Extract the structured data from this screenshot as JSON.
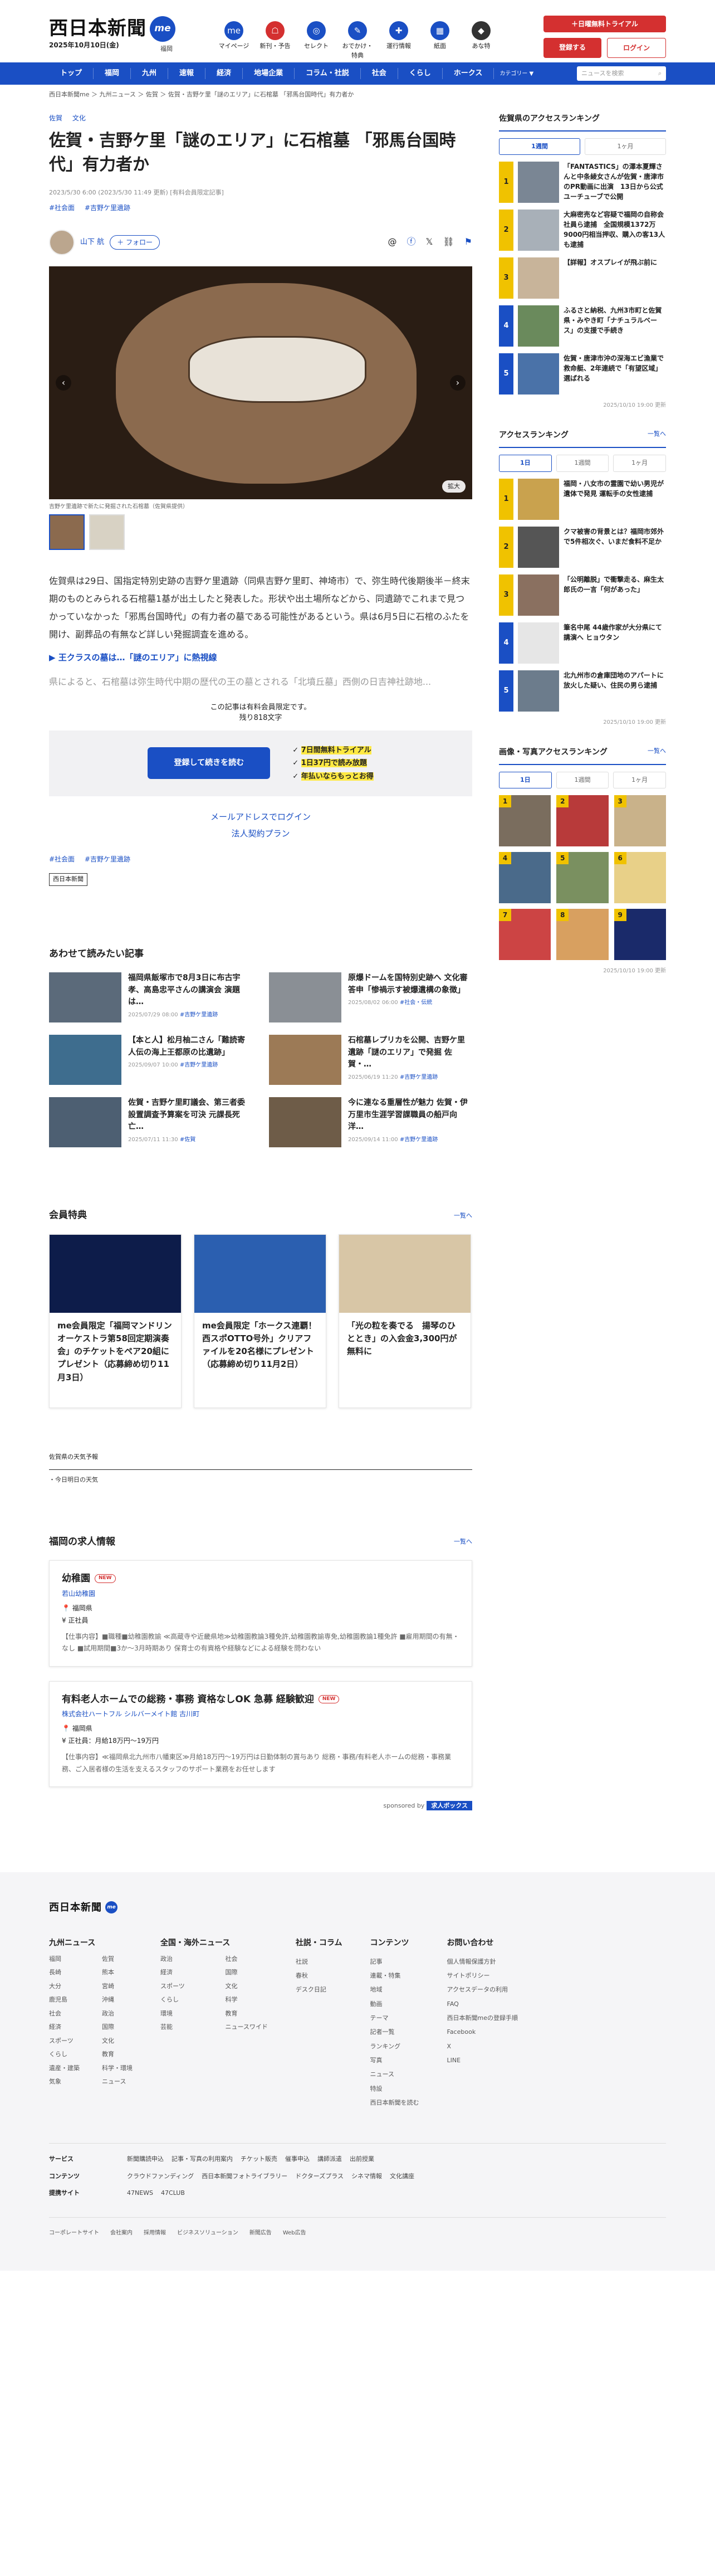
{
  "header": {
    "logo": "西日本新聞",
    "me": "me",
    "date": "2025年10月10日(金)",
    "location": "福岡",
    "icons": [
      {
        "label": "マイページ",
        "glyph": "me"
      },
      {
        "label": "新刊・予告",
        "glyph": "☖"
      },
      {
        "label": "セレクト",
        "glyph": "◎"
      },
      {
        "label": "おでかけ・特典",
        "glyph": "✎"
      },
      {
        "label": "運行情報",
        "glyph": "✚"
      },
      {
        "label": "紙面",
        "glyph": "▦"
      },
      {
        "label": "あな特",
        "glyph": "◆"
      }
    ],
    "trial": "＋日曜無料トライアル",
    "register": "登録する",
    "login": "ログイン"
  },
  "nav": {
    "items": [
      "トップ",
      "福岡",
      "九州",
      "速報",
      "経済",
      "地場企業",
      "コラム・社説",
      "社会",
      "くらし",
      "ホークス"
    ],
    "more": "カテゴリー ▼",
    "search_placeholder": "ニュースを検索"
  },
  "breadcrumb": "西日本新聞me ＞ 九州ニュース ＞ 佐賀 ＞ 佐賀・吉野ケ里「謎のエリア」に石棺墓 「邪馬台国時代」有力者か",
  "article": {
    "categories": [
      "佐賀",
      "文化"
    ],
    "title": "佐賀・吉野ケ里「謎のエリア」に石棺墓 「邪馬台国時代」有力者か",
    "meta": "2023/5/30 6:00 (2023/5/30 11:49 更新) [有料会員限定記事]",
    "tags": [
      "#社会面",
      "#吉野ケ里遺跡"
    ],
    "author": "山下 航",
    "follow": "＋ フォロー",
    "zoom": "拡大",
    "caption": "吉野ケ里遺跡で新たに発掘された石棺墓（佐賀県提供）",
    "p1": "佐賀県は29日、国指定特別史跡の吉野ケ里遺跡（同県吉野ケ里町、神埼市）で、弥生時代後期後半－終末期のものとみられる石棺墓1基が出土したと発表した。形状や出土場所などから、同遺跡でこれまで見つかっていなかった「邪馬台国時代」の有力者の墓である可能性があるという。県は6月5日に石棺のふたを開け、副葬品の有無など詳しい発掘調査を進める。",
    "highlight": "▶ 王クラスの墓は…「謎のエリア」に熱視線",
    "p2": "県によると、石棺墓は弥生時代中期の歴代の王の墓とされる「北墳丘墓」西側の日吉神社跡地...",
    "paywall": "この記事は有料会員限定です。",
    "remaining": "残り818文字",
    "read_btn": "登録して続きを読む",
    "checks": [
      "7日間無料トライアル",
      "1日37円で読み放題",
      "年払いならもっとお得"
    ],
    "mail_login": "メールアドレスでログイン",
    "corp": "法人契約プラン",
    "tags2": [
      "#社会面",
      "#吉野ケ里遺跡"
    ],
    "copyright": "西日本新聞"
  },
  "related": {
    "title": "あわせて読みたい記事",
    "items": [
      {
        "title": "福岡県飯塚市で8月3日に布古宇孝、高島忠平さんの講演会 演題は…",
        "date": "2025/07/29 08:00",
        "tag": "#吉野ケ里遺跡"
      },
      {
        "title": "原爆ドームを国特別史跡へ 文化審答申「惨禍示す被爆遺構の象徴」",
        "date": "2025/08/02 06:00",
        "tag": "#社会・伝統"
      },
      {
        "title": "【本と人】松月柚二さん「難読寄人伝の海上王都原の比遺跡」",
        "date": "2025/09/07 10:00",
        "tag": "#吉野ケ里遺跡"
      },
      {
        "title": "石棺墓レプリカを公開、吉野ケ里遺跡「謎のエリア」で発掘 佐賀・…",
        "date": "2025/06/19 11:20",
        "tag": "#吉野ケ里遺跡"
      },
      {
        "title": "佐賀・吉野ケ里町議会、第三者委設置調査予算案を可決 元課長死亡…",
        "date": "2025/07/11 11:30",
        "tag": "#佐賀"
      },
      {
        "title": "今に連なる重層性が魅力 佐賀・伊万里市生涯学習課職員の船戸向洋…",
        "date": "2025/09/14 11:00",
        "tag": "#吉野ケ里遺跡"
      }
    ]
  },
  "perks": {
    "title": "会員特典",
    "more": "一覧へ",
    "items": [
      "me会員限定「福岡マンドリンオーケストラ第58回定期演奏会」のチケットをペア20組にプレゼント（応募締め切り11月3日）",
      "me会員限定「ホークス連覇！西スポOTTO号外」クリアファイルを20名様にプレゼント（応募締め切り11月2日）",
      "「光の粒を奏でる　揚琴のひととき」の入会金3,300円が無料に"
    ]
  },
  "weather": {
    "title": "佐賀県の天気予報",
    "sub": "・今日明日の天気"
  },
  "jobs": {
    "title": "福岡の求人情報",
    "more": "一覧へ",
    "items": [
      {
        "title": "幼稚園",
        "badge": "NEW",
        "company": "若山幼稚園",
        "place": "福岡県",
        "pay": "正社員",
        "desc": "【仕事内容】■職種■幼稚園教諭 ≪高蔵寺や近畿県地≫幼稚園教論3種免許,幼稚園教諭専免,幼稚園教論1種免許 ■雇用期間の有無・なし ■試用期間■3か〜3月時期あり 保育士の有資格や経験などによる経験を問わない"
      },
      {
        "title": "有料老人ホームでの総務・事務 資格なしOK 急募 経験歓迎",
        "badge": "NEW",
        "company": "株式会社ハートフル シルバーメイト館 古川町",
        "place": "福岡県",
        "pay": "正社員：月給18万円〜19万円",
        "desc": "【仕事内容】≪福岡県北九州市八幡東区≫月給18万円〜19万円は日勤体制の賞与あり 総務・事務/有料老人ホームの総務・事務業務、ご入居者様の生活を支えるスタッフのサポート業務をお任せします"
      }
    ],
    "sponsored": "sponsored by",
    "sponsor": "求人ボックス"
  },
  "sidebar": {
    "rank1_title": "佐賀県のアクセスランキング",
    "rank1_tabs": [
      "1週間",
      "1ヶ月"
    ],
    "rank1": [
      "「FANTASTICS」の澤本夏輝さんと中条綾女さんが佐賀・唐津市のPR動画に出演　13日から公式ユーチューブで公開",
      "大麻密売など容疑で福岡の自称会社員ら逮捕　全国規模1372万9000円相当押収、購入の客13人も逮捕",
      "【詳報】オスプレイが飛ぶ前に",
      "ふるさと納税、九州3市町と佐賀県・みやき町「ナチュラルベース」の支援で手続き",
      "佐賀・唐津市沖の深海エビ漁業で救命艇、2年連続で「有望区域」選ばれる"
    ],
    "rank1_upd": "2025/10/10 19:00 更新",
    "rank2_title": "アクセスランキング",
    "rank2_more": "一覧へ",
    "rank2_tabs": [
      "1日",
      "1週間",
      "1ヶ月"
    ],
    "rank2": [
      "福岡・八女市の霊園で幼い男児が遺体で発見 運転手の女性逮捕",
      "クマ被害の背景とは？福岡市郊外で5件相次ぐ、いまだ食料不足か",
      "「公明離脱」で衝撃走る、麻生太郎氏の一言「何があった」",
      "筆名中尾 44歳作家が大分県にて講演へ ヒョウタン",
      "北九州市の倉庫団地のアパートに放火した疑い、住民の男ら逮捕"
    ],
    "rank2_upd": "2025/10/10 19:00 更新",
    "rank3_title": "画像・写真アクセスランキング",
    "rank3_more": "一覧へ",
    "rank3_tabs": [
      "1日",
      "1週間",
      "1ヶ月"
    ],
    "rank3_nums": [
      "1",
      "2",
      "3",
      "4",
      "5",
      "6",
      "7",
      "8",
      "9"
    ],
    "rank3_upd": "2025/10/10 19:00 更新"
  },
  "footer": {
    "logo": "西日本新聞",
    "me": "me",
    "cols": [
      {
        "title": "九州ニュース",
        "items": [
          "福岡",
          "佐賀",
          "長崎",
          "熊本",
          "大分",
          "宮崎",
          "鹿児島",
          "沖縄",
          "社会",
          "政治",
          "経済",
          "国際",
          "スポーツ",
          "文化",
          "くらし",
          "教育",
          "遺産・建築",
          "科学・環境",
          "気象",
          "ニュース"
        ]
      },
      {
        "title": "全国・海外ニュース",
        "items": [
          "政治",
          "社会",
          "経済",
          "国際",
          "スポーツ",
          "文化",
          "くらし",
          "科学",
          "環境",
          "教育",
          "芸能",
          "ニュースワイド"
        ]
      },
      {
        "title": "社説・コラム",
        "items": [
          "社説",
          "春秋",
          "デスク日記"
        ]
      },
      {
        "title": "コンテンツ",
        "items": [
          "記事",
          "連載・特集",
          "地域",
          "動画",
          "テーマ",
          "記者一覧",
          "ランキング",
          "写真",
          "ニュース",
          "特設",
          "西日本新聞を読む"
        ]
      },
      {
        "title": "お問い合わせ",
        "items": [
          "個人情報保護方針",
          "サイトポリシー",
          "アクセスデータの利用",
          "FAQ",
          "西日本新聞meの登録手順",
          "Facebook",
          "X",
          "LINE"
        ]
      }
    ],
    "rows": [
      {
        "title": "サービス",
        "items": [
          "新聞購読申込",
          "記事・写真の利用案内",
          "チケット販売",
          "催事申込",
          "講師派遣",
          "出前授業"
        ]
      },
      {
        "title": "コンテンツ",
        "items": [
          "クラウドファンディング",
          "西日本新聞フォトライブラリー",
          "ドクターズプラス",
          "シネマ情報",
          "文化講座"
        ]
      },
      {
        "title": "提携サイト",
        "items": [
          "47NEWS",
          "47CLUB"
        ]
      }
    ],
    "bottom": [
      "コーポレートサイト",
      "会社案内",
      "採用情報",
      "ビジネスソリューション",
      "新聞広告",
      "Web広告"
    ]
  },
  "colors": {
    "brand": "#1a4fc4",
    "accent": "#d43030",
    "highlight": "#ffe943"
  }
}
